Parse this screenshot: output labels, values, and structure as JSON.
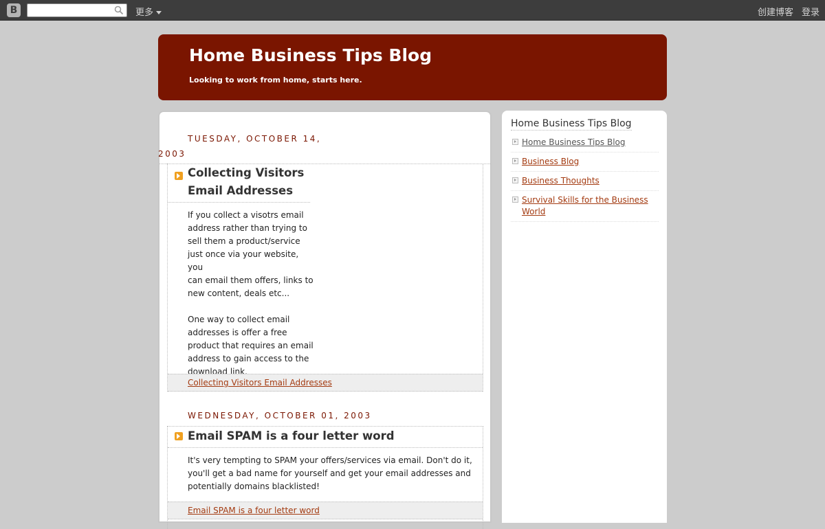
{
  "navbar": {
    "logo_glyph": "B",
    "search_value": "",
    "more_label": "更多",
    "create_blog_label": "创建博客",
    "login_label": "登录"
  },
  "header": {
    "title": "Home Business Tips Blog",
    "description": "Looking to work from home, starts here."
  },
  "posts": [
    {
      "date_line1": "TUESDAY, OCTOBER 14,",
      "date_line2": "2003",
      "title_line1": "Collecting Visitors",
      "title_line2": "Email Addresses",
      "body_p1": [
        "If you collect a visotrs email",
        "address rather than trying to",
        "sell them a product/service",
        "just once via your website, you",
        "can email them offers, links to",
        "new content, deals etc..."
      ],
      "body_p2": [
        "One way to collect email",
        "addresses is offer a free",
        "product that requires an email",
        "address to gain access to the",
        "download link."
      ],
      "footer_link": "Collecting Visitors Email Addresses"
    },
    {
      "date": "WEDNESDAY, OCTOBER 01, 2003",
      "title": "Email SPAM is a four letter word",
      "body_lines": [
        "It's very tempting to SPAM your offers/services via email. Don't do it,",
        "you'll get a bad name for yourself and get your email addresses and",
        "potentially domains blacklisted!"
      ],
      "footer_link": "Email SPAM is a four letter word"
    }
  ],
  "sidebar": {
    "widget_title": "Home Business Tips Blog",
    "links": [
      {
        "line1": "Home Business Tips Blog"
      },
      {
        "line1": "Business Blog"
      },
      {
        "line1": "Business Thoughts"
      },
      {
        "line1": "Survival Skills for the Business",
        "line2": "World"
      }
    ]
  }
}
